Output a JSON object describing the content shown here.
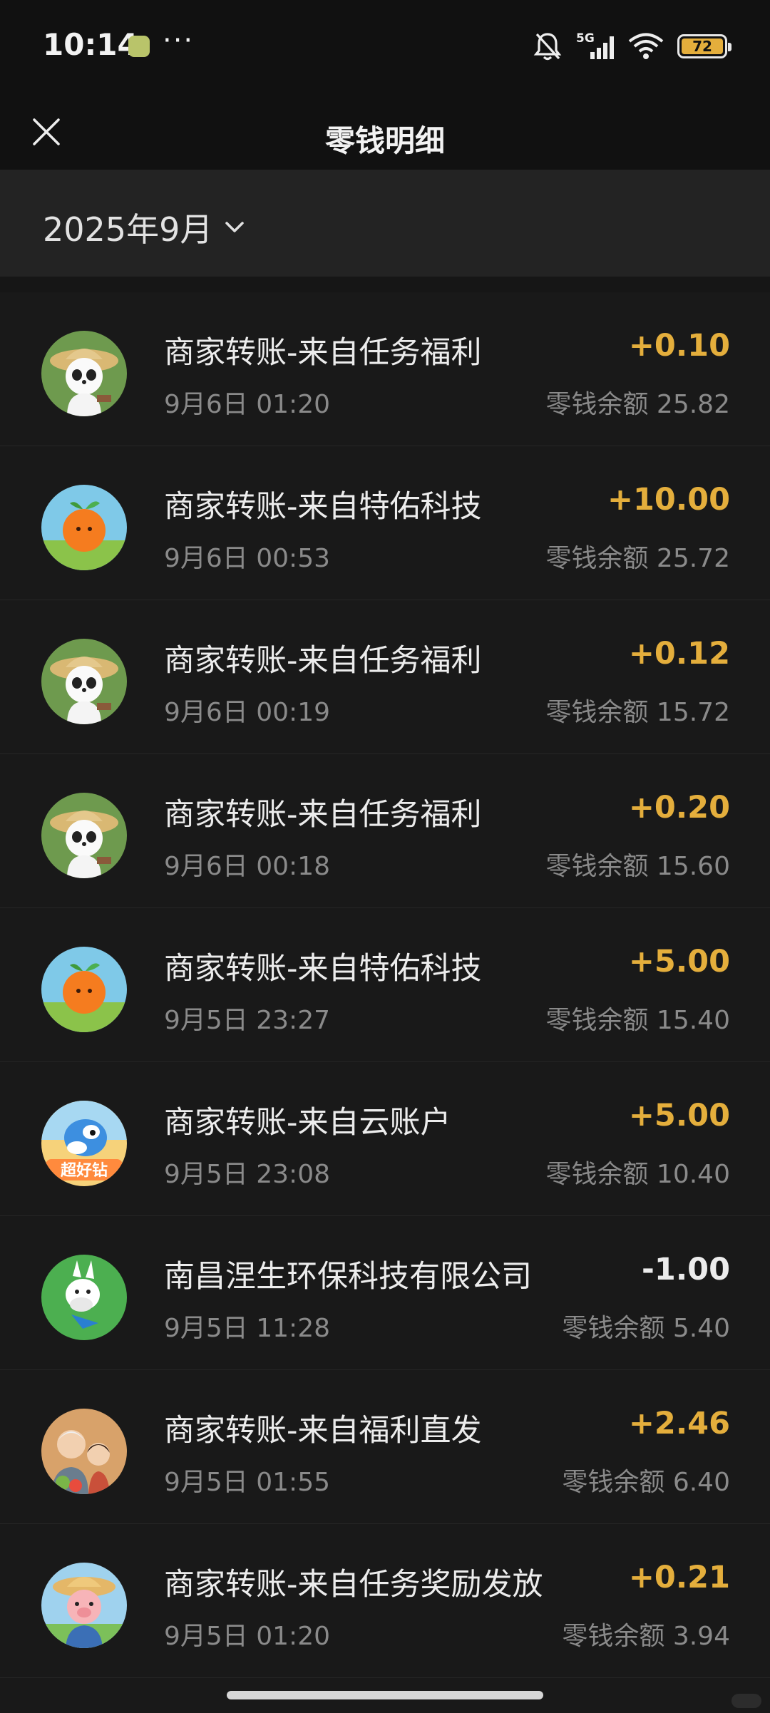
{
  "status_bar": {
    "time": "10:14",
    "more": "···",
    "network": "5G",
    "battery": "72"
  },
  "nav": {
    "title": "零钱明细"
  },
  "filter": {
    "month": "2025年9月"
  },
  "balance_prefix": "零钱余额",
  "transactions": [
    {
      "title": "商家转账-来自任务福利",
      "time": "9月6日 01:20",
      "amount": "+0.10",
      "balance": "零钱余额 25.82",
      "avatar": "panda"
    },
    {
      "title": "商家转账-来自特佑科技",
      "time": "9月6日 00:53",
      "amount": "+10.00",
      "balance": "零钱余额 25.72",
      "avatar": "orange"
    },
    {
      "title": "商家转账-来自任务福利",
      "time": "9月6日 00:19",
      "amount": "+0.12",
      "balance": "零钱余额 15.72",
      "avatar": "panda"
    },
    {
      "title": "商家转账-来自任务福利",
      "time": "9月6日 00:18",
      "amount": "+0.20",
      "balance": "零钱余额 15.60",
      "avatar": "panda"
    },
    {
      "title": "商家转账-来自特佑科技",
      "time": "9月5日 23:27",
      "amount": "+5.00",
      "balance": "零钱余额 15.40",
      "avatar": "orange"
    },
    {
      "title": "商家转账-来自云账户",
      "time": "9月5日 23:08",
      "amount": "+5.00",
      "balance": "零钱余额 10.40",
      "avatar": "dino",
      "avatar_text": "超好钻"
    },
    {
      "title": "南昌涅生环保科技有限公司",
      "time": "9月5日 11:28",
      "amount": "-1.00",
      "balance": "零钱余额 5.40",
      "avatar": "donkey"
    },
    {
      "title": "商家转账-来自福利直发",
      "time": "9月5日 01:55",
      "amount": "+2.46",
      "balance": "零钱余额 6.40",
      "avatar": "family"
    },
    {
      "title": "商家转账-来自任务奖励发放",
      "time": "9月5日 01:20",
      "amount": "+0.21",
      "balance": "零钱余额 3.94",
      "avatar": "pig"
    }
  ],
  "colors": {
    "income": "#e4ae3c",
    "expense": "#ececec",
    "background": "#191919"
  }
}
